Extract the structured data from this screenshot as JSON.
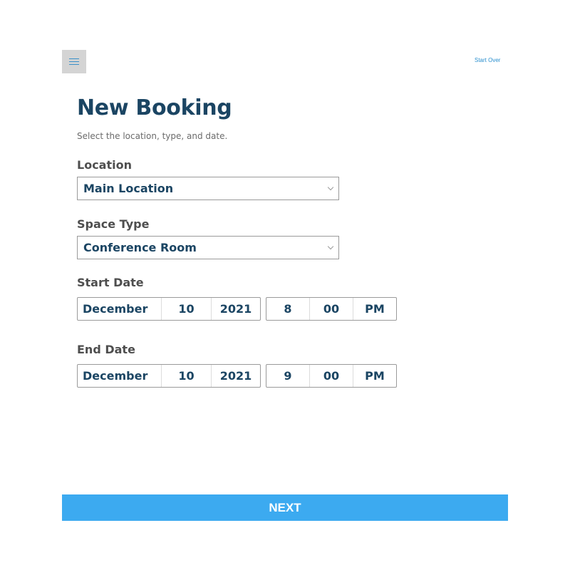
{
  "header": {
    "menu_icon": "hamburger-menu-icon",
    "start_over_label": "Start Over"
  },
  "page": {
    "title": "New Booking",
    "subtitle": "Select the location, type, and date."
  },
  "location": {
    "label": "Location",
    "value": "Main Location",
    "icon": "chevron-down-icon"
  },
  "space_type": {
    "label": "Space Type",
    "value": "Conference Room",
    "icon": "chevron-down-icon"
  },
  "start_date": {
    "label": "Start Date",
    "month": "December",
    "day": "10",
    "year": "2021",
    "hour": "8",
    "minute": "00",
    "period": "PM"
  },
  "end_date": {
    "label": "End Date",
    "month": "December",
    "day": "10",
    "year": "2021",
    "hour": "9",
    "minute": "00",
    "period": "PM"
  },
  "footer": {
    "next_label": "NEXT"
  },
  "colors": {
    "primary_text": "#1b4563",
    "accent": "#3caaf0",
    "link": "#2a8fce"
  }
}
